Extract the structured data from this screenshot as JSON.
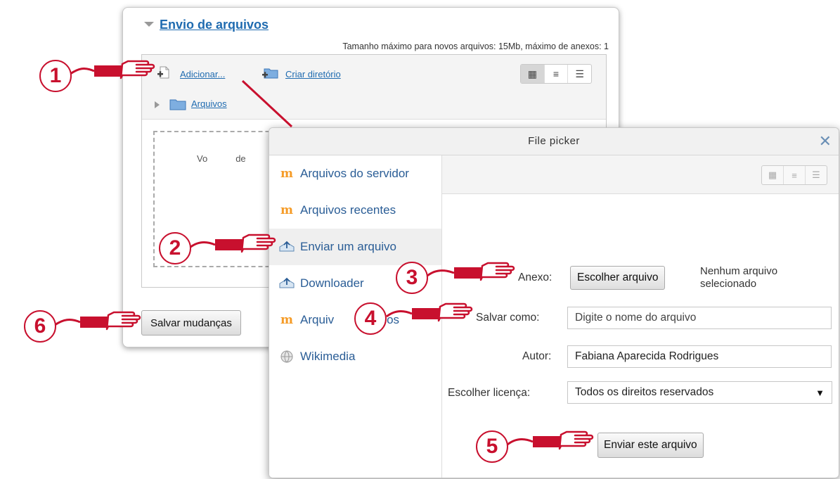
{
  "panel": {
    "title": "Envio de arquivos",
    "max_info": "Tamanho máximo para novos arquivos: 15Mb, máximo de anexos: 1",
    "add_link": "Adicionar...",
    "create_dir_link": "Criar diretório",
    "path_link": "Arquivos",
    "dropzone_text": "Vo",
    "dropzone_text_tail": "de",
    "save_button": "Salvar mudanças"
  },
  "picker": {
    "title": "File picker",
    "close_glyph": "✕",
    "repositories": [
      {
        "label": "Arquivos do servidor",
        "icon": "moodle-icon"
      },
      {
        "label": "Arquivos recentes",
        "icon": "moodle-icon"
      },
      {
        "label": "Enviar um arquivo",
        "icon": "upload-icon",
        "active": true
      },
      {
        "label": "Downloader",
        "icon": "upload-icon"
      },
      {
        "label": "Arquiv",
        "icon": "moodle-icon"
      },
      {
        "label": "Wikimedia",
        "icon": "globe-icon"
      }
    ],
    "repo_4_suffix": "ados",
    "form": {
      "attachment_label": "Anexo:",
      "choose_button": "Escolher arquivo",
      "no_file_text": "Nenhum arquivo selecionado",
      "save_as_label": "Salvar como:",
      "save_as_placeholder": "Digite o nome do arquivo",
      "author_label": "Autor:",
      "author_value": "Fabiana Aparecida Rodrigues",
      "license_label": "Escolher licença:",
      "license_value": "Todos os direitos reservados",
      "upload_button": "Enviar este arquivo"
    }
  },
  "callouts": [
    "1",
    "2",
    "3",
    "4",
    "5",
    "6"
  ],
  "colors": {
    "link": "#1f6bb0",
    "callout": "#c8102e",
    "moodle": "#f59b26"
  }
}
